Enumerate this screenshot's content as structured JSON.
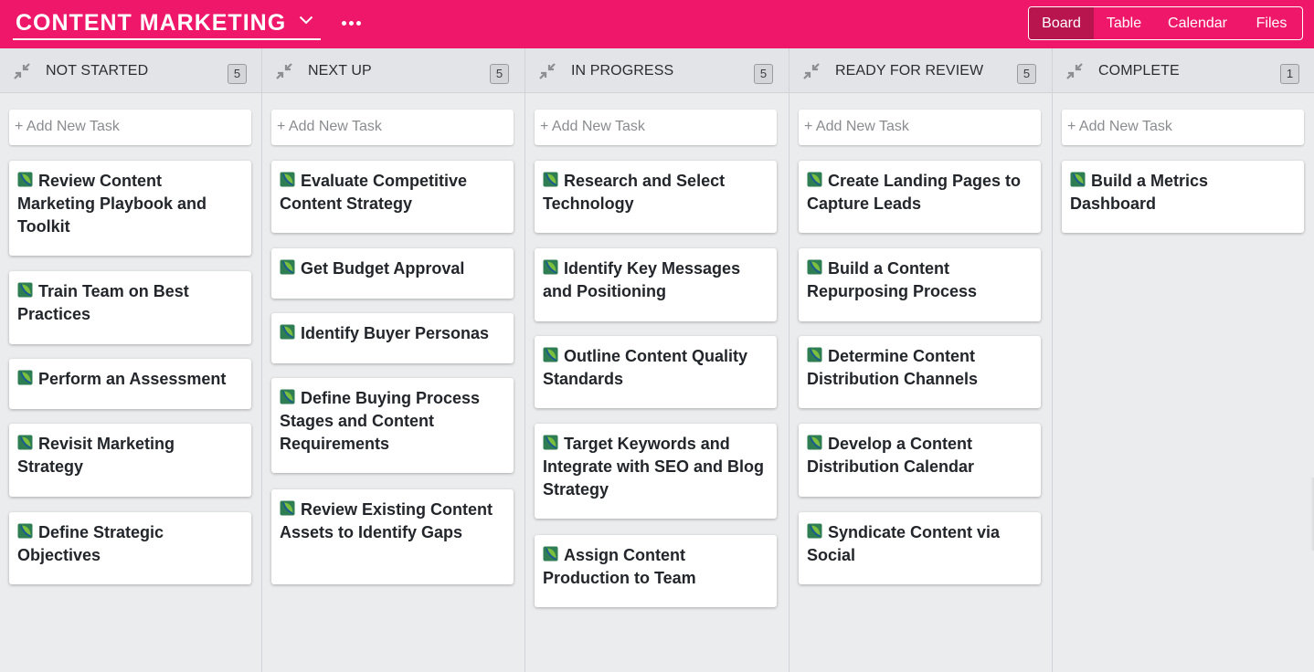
{
  "header": {
    "title": "CONTENT MARKETING",
    "background": "#ef1769",
    "views": [
      "Board",
      "Table",
      "Calendar",
      "Files"
    ],
    "active_view": "Board"
  },
  "add_task_placeholder": "+ Add New Task",
  "columns": [
    {
      "title": "NOT STARTED",
      "count": "5",
      "cards": [
        "Review Content Marketing Playbook and Toolkit",
        "Train Team on Best Practices",
        "Perform an Assessment",
        "Revisit Marketing Strategy",
        "Define Strategic Objectives"
      ]
    },
    {
      "title": "NEXT UP",
      "count": "5",
      "cards": [
        "Evaluate Competitive Content Strategy",
        "Get Budget Approval",
        "Identify Buyer Personas",
        "Define Buying Process Stages and Content Requirements",
        "Review Existing Content Assets to Identify Gaps"
      ]
    },
    {
      "title": "IN PROGRESS",
      "count": "5",
      "cards": [
        "Research and Select Technology",
        "Identify Key Messages and Positioning",
        "Outline Content Quality Standards",
        "Target Keywords and Integrate with SEO and Blog Strategy",
        "Assign Content Production to Team"
      ]
    },
    {
      "title": "READY FOR REVIEW",
      "count": "5",
      "cards": [
        "Create Landing Pages to Capture Leads",
        "Build a Content Repurposing Process",
        "Determine Content Distribution Channels",
        "Develop a Content Distribution Calendar",
        "Syndicate Content via Social"
      ]
    },
    {
      "title": "COMPLETE",
      "count": "1",
      "cards": [
        "Build a Metrics Dashboard"
      ]
    }
  ]
}
